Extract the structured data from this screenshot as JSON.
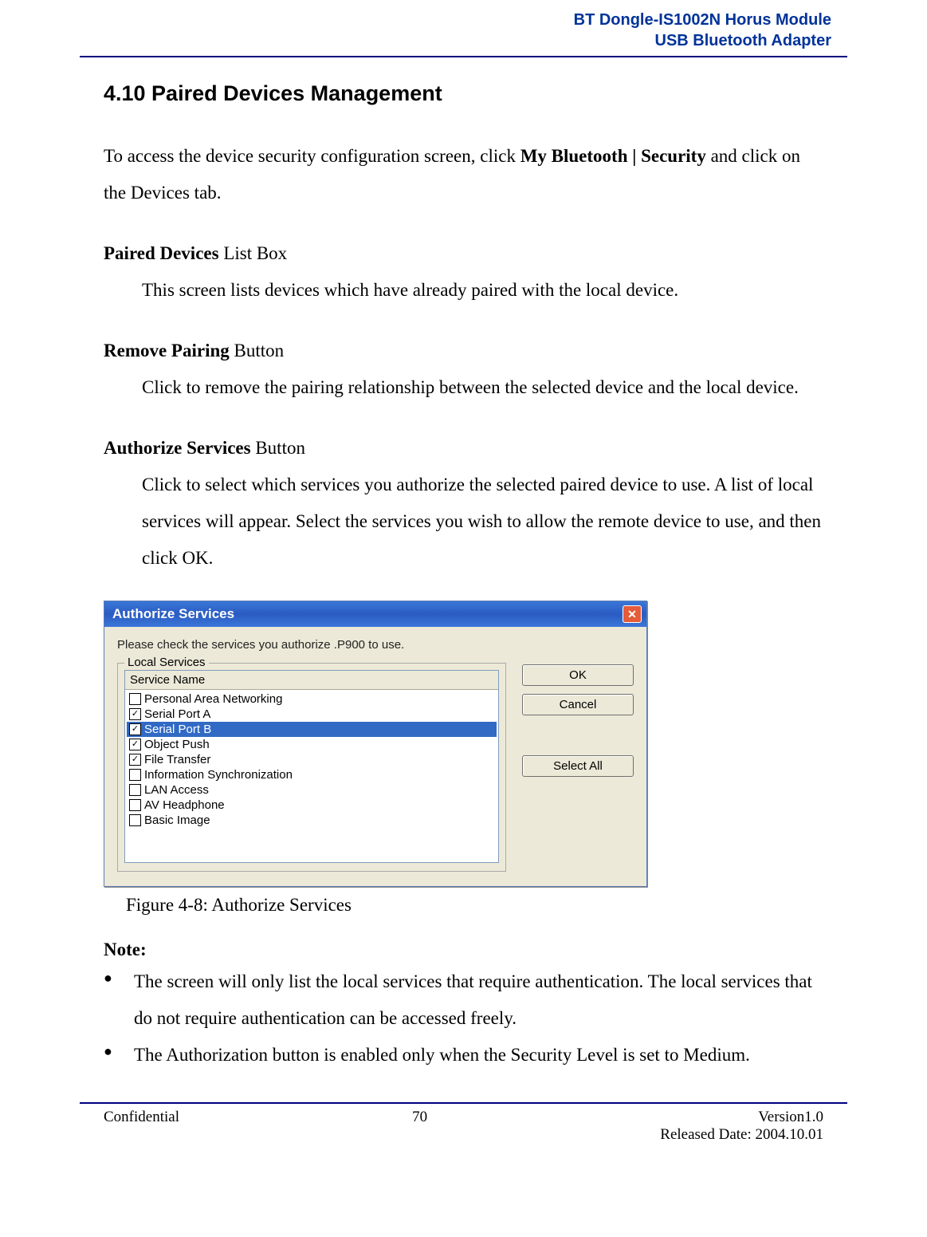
{
  "header": {
    "line1": "BT Dongle-IS1002N Horus Module",
    "line2": "USB Bluetooth Adapter"
  },
  "section": {
    "title": "4.10 Paired Devices Management",
    "intro_pre": "To access the device security configuration screen, click ",
    "intro_bold": "My Bluetooth | Security",
    "intro_post": " and click on the Devices tab."
  },
  "defs": {
    "paired_bold": "Paired Devices",
    "paired_rest": " List Box",
    "paired_desc": "This screen lists devices which have already paired with the local device.",
    "remove_bold": "Remove Pairing",
    "remove_rest": " Button",
    "remove_desc": "Click to remove the pairing relationship between the selected device and the local device.",
    "auth_bold": "Authorize Services",
    "auth_rest": " Button",
    "auth_desc": "Click to select which services you authorize the selected paired device to use. A list of local services will appear. Select the services you wish to allow the remote device to use, and then click OK."
  },
  "dialog": {
    "title": "Authorize Services",
    "prompt": "Please check the services you authorize .P900 to use.",
    "group_label": "Local Services",
    "list_header": "Service Name",
    "items": [
      {
        "label": "Personal Area Networking",
        "checked": false,
        "selected": false
      },
      {
        "label": "Serial Port A",
        "checked": true,
        "selected": false
      },
      {
        "label": "Serial Port B",
        "checked": true,
        "selected": true
      },
      {
        "label": "Object Push",
        "checked": true,
        "selected": false
      },
      {
        "label": "File Transfer",
        "checked": true,
        "selected": false
      },
      {
        "label": "Information Synchronization",
        "checked": false,
        "selected": false
      },
      {
        "label": "LAN Access",
        "checked": false,
        "selected": false
      },
      {
        "label": "AV Headphone",
        "checked": false,
        "selected": false
      },
      {
        "label": "Basic Image",
        "checked": false,
        "selected": false
      }
    ],
    "buttons": {
      "ok": "OK",
      "cancel": "Cancel",
      "select_all": "Select All"
    }
  },
  "figure_caption": "Figure 4-8: Authorize Services",
  "note": {
    "label": "Note:",
    "items": [
      "The screen will only list the local services that require authentication. The local services that do not require authentication can be accessed freely.",
      "The Authorization button is enabled only when the Security Level is set to Medium."
    ]
  },
  "footer": {
    "left": "Confidential",
    "center": "70",
    "right1": "Version1.0",
    "right2": "Released Date: 2004.10.01"
  }
}
